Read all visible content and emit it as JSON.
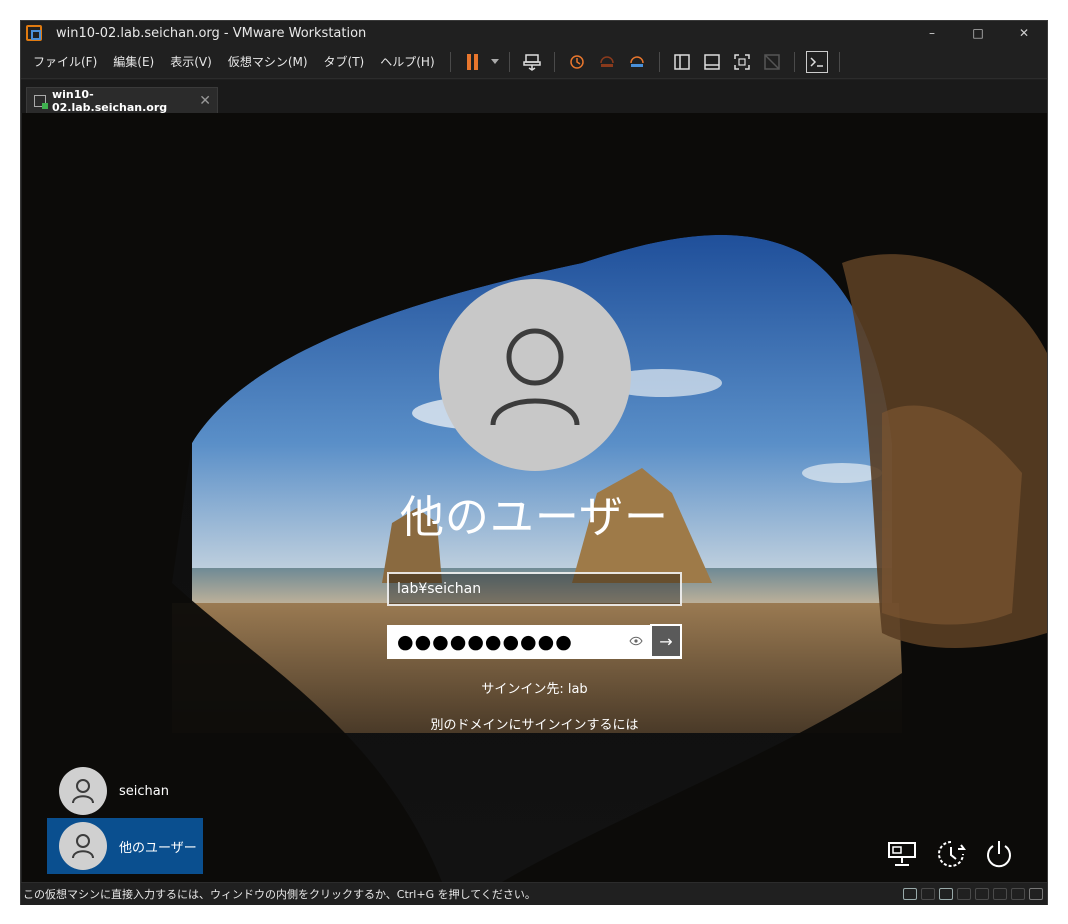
{
  "window": {
    "title": "win10-02.lab.seichan.org - VMware Workstation",
    "minimize": "–",
    "maximize": "□",
    "close": "✕"
  },
  "menu": {
    "items": [
      "ファイル(F)",
      "編集(E)",
      "表示(V)",
      "仮想マシン(M)",
      "タブ(T)",
      "ヘルプ(H)"
    ]
  },
  "toolbar": {
    "icons": [
      "pause-icon",
      "send-ctrl-alt-del-icon",
      "snapshot-icon",
      "revert-snapshot-icon",
      "snapshot-manager-icon",
      "library-view-icon",
      "thumbnail-view-icon",
      "fullscreen-icon",
      "unity-icon",
      "console-view-icon"
    ],
    "accent": "#e8762d"
  },
  "tab": {
    "label": "win10-02.lab.seichan.org",
    "close": "✕"
  },
  "login": {
    "display_name": "他のユーザー",
    "username_value": "lab¥seichan",
    "password_masked": "●●●●●●●●●●",
    "reveal": "👁",
    "submit_arrow": "→",
    "signin_to": "サインイン先: lab",
    "other_domain_link": "別のドメインにサインインするには"
  },
  "users": [
    {
      "name": "seichan",
      "selected": false
    },
    {
      "name": "他のユーザー",
      "selected": true
    }
  ],
  "system_icons": [
    "network-icon",
    "ease-of-access-icon",
    "power-icon"
  ],
  "statusbar": {
    "hint": "この仮想マシンに直接入力するには、ウィンドウの内側をクリックするか、Ctrl+G を押してください。"
  },
  "colors": {
    "selected_tile": "#0a4f8f",
    "chrome_bg": "#202020"
  }
}
